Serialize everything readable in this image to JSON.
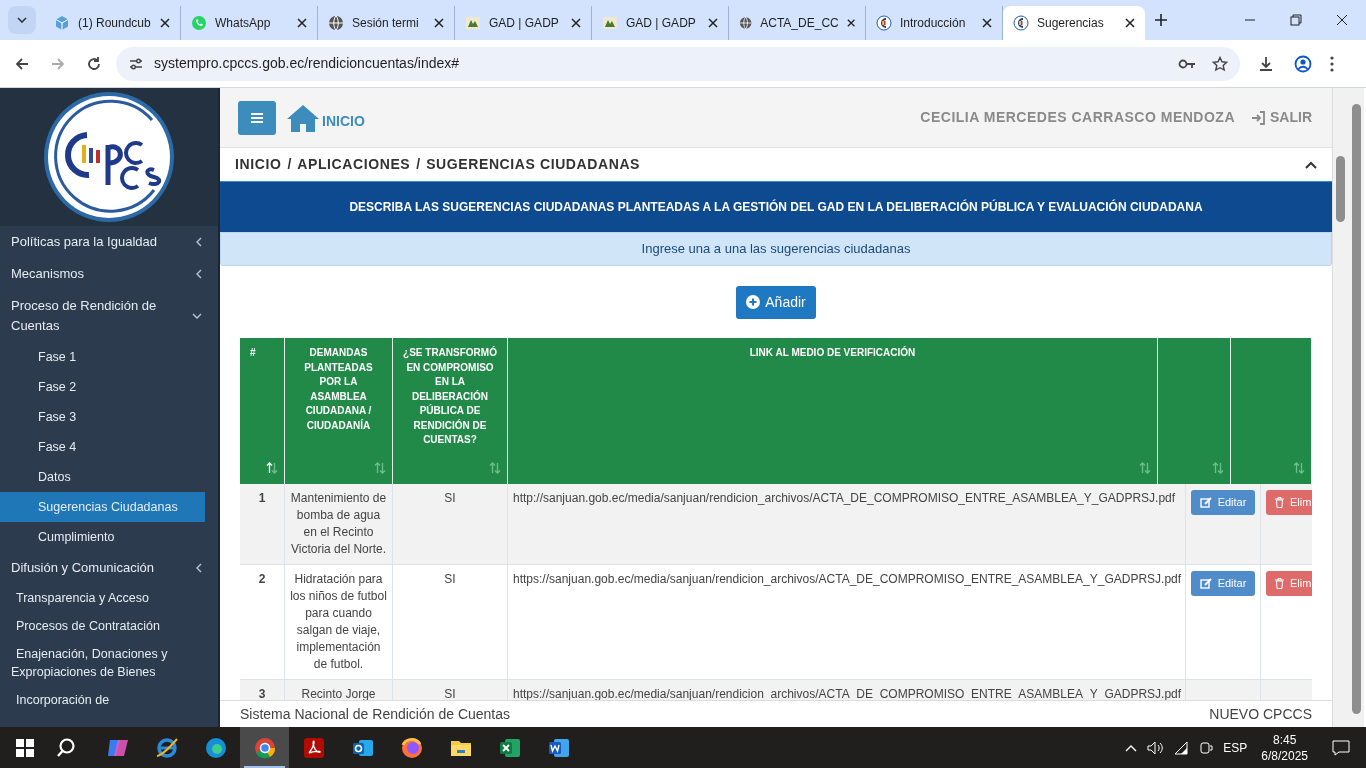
{
  "browser": {
    "tabs": [
      {
        "title": "(1) Roundcub",
        "selected": false
      },
      {
        "title": "WhatsApp",
        "selected": false
      },
      {
        "title": "Sesión termi",
        "selected": false
      },
      {
        "title": "GAD | GADP",
        "selected": false
      },
      {
        "title": "GAD | GADP",
        "selected": false
      },
      {
        "title": "ACTA_DE_CC",
        "selected": false
      },
      {
        "title": "Introducción",
        "selected": false
      },
      {
        "title": "Sugerencias",
        "selected": true
      }
    ],
    "url": "systempro.cpccs.gob.ec/rendicioncuentas/index#"
  },
  "sidebar": {
    "items": [
      {
        "label": "Políticas para la Igualdad",
        "kind": "group",
        "expanded": false
      },
      {
        "label": "Mecanismos",
        "kind": "group",
        "expanded": false
      },
      {
        "label": "Proceso de Rendición de Cuentas",
        "kind": "group",
        "expanded": true
      },
      {
        "label": "Fase 1",
        "kind": "sub",
        "selected": false
      },
      {
        "label": "Fase 2",
        "kind": "sub",
        "selected": false
      },
      {
        "label": "Fase 3",
        "kind": "sub",
        "selected": false
      },
      {
        "label": "Fase 4",
        "kind": "sub",
        "selected": false
      },
      {
        "label": "Datos",
        "kind": "sub",
        "selected": false
      },
      {
        "label": "Sugerencias Ciudadanas",
        "kind": "sub",
        "selected": true
      },
      {
        "label": "Cumplimiento",
        "kind": "sub",
        "selected": false
      },
      {
        "label": "Difusión y Comunicación",
        "kind": "group",
        "expanded": false
      },
      {
        "label": "Transparencia y Acceso",
        "kind": "link"
      },
      {
        "label": "Procesos de Contratación",
        "kind": "link"
      },
      {
        "label": "Enajenación, Donaciones y Expropiaciones de Bienes",
        "kind": "link"
      },
      {
        "label": "Incorporación de",
        "kind": "link"
      }
    ]
  },
  "header": {
    "home": "INICIO",
    "user": "CECILIA MERCEDES CARRASCO MENDOZA",
    "logout": "SALIR"
  },
  "breadcrumb": {
    "separator": "/",
    "items": [
      "INICIO",
      "APLICACIONES",
      "SUGERENCIAS CIUDADANAS"
    ]
  },
  "banner": "DESCRIBA LAS SUGERENCIAS CIUDADANAS PLANTEADAS A LA GESTIÓN DEL GAD EN LA DELIBERACIÓN PÚBLICA Y EVALUACIÓN CIUDADANA",
  "info": "Ingrese una a una las sugerencias ciudadanas",
  "add_button": "Añadir",
  "table": {
    "columns": [
      {
        "label": "#",
        "sorted": true
      },
      {
        "label": "DEMANDAS PLANTEADAS POR LA ASAMBLEA CIUDADANA / CIUDADANÍA",
        "sorted": false
      },
      {
        "label": "¿SE TRANSFORMÓ EN COMPROMISO EN LA DELIBERACIÓN PÚBLICA DE RENDICIÓN DE CUENTAS?",
        "sorted": false
      },
      {
        "label": "LINK AL MEDIO DE VERIFICACIÓN",
        "sorted": false
      },
      {
        "sorted": false
      },
      {
        "sorted": false
      }
    ],
    "rows": [
      {
        "number": "1",
        "demand": "Mantenimiento de bomba de agua en el Recinto Victoria del Norte.",
        "transformed": "SI",
        "link": "http://sanjuan.gob.ec/media/sanjuan/rendicion_archivos/ACTA_DE_COMPROMISO_ENTRE_ASAMBLEA_Y_GADPRSJ.pdf",
        "edit": "Editar",
        "delete": "Elim"
      },
      {
        "number": "2",
        "demand": "Hidratación para los niños de futbol para cuando salgan de viaje, implementación de futbol.",
        "transformed": "SI",
        "link": "https://sanjuan.gob.ec/media/sanjuan/rendicion_archivos/ACTA_DE_COMPROMISO_ENTRE_ASAMBLEA_Y_GADPRSJ.pdf",
        "edit": "Editar",
        "delete": "Elim"
      },
      {
        "number": "3",
        "demand": "Recinto Jorge",
        "transformed": "SI",
        "link": "https://sanjuan.gob.ec/media/sanjuan/rendicion_archivos/ACTA_DE_COMPROMISO_ENTRE_ASAMBLEA_Y_GADPRSJ.pdf"
      }
    ]
  },
  "footer": {
    "left": "Sistema Nacional de Rendición de Cuentas",
    "right": "NUEVO CPCCS"
  },
  "taskbar": {
    "apps": [
      {
        "active": false
      },
      {
        "active": false
      },
      {
        "active": false
      },
      {
        "active": false
      },
      {
        "active": true
      },
      {
        "active": false
      },
      {
        "active": false
      },
      {
        "active": false
      },
      {
        "active": false
      },
      {
        "active": false
      },
      {
        "active": false
      }
    ],
    "language": "ESP",
    "time": "8:45",
    "date": "6/8/2025"
  }
}
